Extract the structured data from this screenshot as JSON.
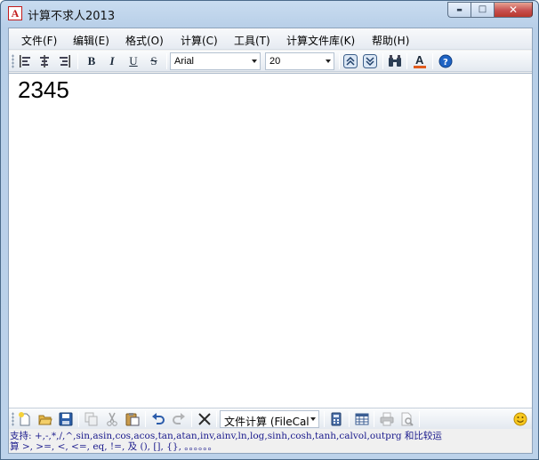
{
  "window": {
    "title": "计算不求人2013",
    "app_icon_glyph": "A",
    "minimize_glyph": "▬",
    "maximize_glyph": "□",
    "close_glyph": "✕"
  },
  "menubar": {
    "items": [
      "文件(F)",
      "编辑(E)",
      "格式(O)",
      "计算(C)",
      "工具(T)",
      "计算文件库(K)",
      "帮助(H)"
    ]
  },
  "format_toolbar": {
    "bold_label": "B",
    "italic_label": "I",
    "underline_label": "U",
    "strike_label": "S",
    "font_name": "Arial",
    "font_size": "20",
    "font_color": "#e05a1c",
    "help_color": "#1e63c4",
    "icons": [
      "align-left-icon",
      "align-center-icon",
      "align-right-icon",
      "bold-icon",
      "italic-icon",
      "underline-icon",
      "strikethrough-icon",
      "font-select",
      "size-select",
      "scroll-up-icon",
      "scroll-down-icon",
      "find-icon",
      "font-color-icon",
      "help-icon"
    ]
  },
  "editor": {
    "content": "2345"
  },
  "bottom_toolbar": {
    "calc_mode": "文件计算 (FileCal",
    "icons": [
      "new-file-icon",
      "open-folder-icon",
      "save-icon",
      "copy-icon",
      "cut-icon",
      "paste-icon",
      "undo-icon",
      "redo-icon",
      "delete-icon",
      "calc-mode-select",
      "calculator-icon",
      "table-icon",
      "print-icon",
      "print-preview-icon",
      "smiley-icon"
    ]
  },
  "status": {
    "line1": "支持: +,-,*,/,^,sin,asin,cos,acos,tan,atan,inv,ainv,ln,log,sinh,cosh,tanh,calvol,outprg 和比较运",
    "line2": "算 >, >=, <, <=, eq, !=, 及 (), [], {}, 。。。。。。"
  }
}
